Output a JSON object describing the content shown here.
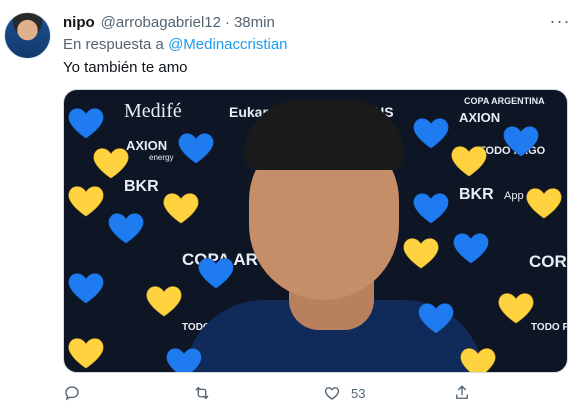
{
  "author": {
    "name": "nipo",
    "handle": "@arrobagabriel12",
    "separator": "·",
    "time": "38min"
  },
  "reply": {
    "prefix": "En respuesta a",
    "mention": "@Medinaccristian"
  },
  "tweet_text": "Yo también te amo",
  "media": {
    "sponsors": [
      "Medifé",
      "Eukan",
      "RUS",
      "COPA ARGENTINA",
      "AXION",
      "energy",
      "TODO PAGO",
      "BKR",
      "App",
      "COPA AR",
      "COR"
    ],
    "colors": {
      "heart_blue": "#1e7bf0",
      "heart_yellow": "#ffd23f",
      "background": "#0e1524"
    }
  },
  "actions": {
    "reply_count": "",
    "retweet_count": "",
    "like_count": "53",
    "share": ""
  },
  "icons": [
    "more-icon",
    "reply-icon",
    "retweet-icon",
    "like-icon",
    "share-icon"
  ]
}
